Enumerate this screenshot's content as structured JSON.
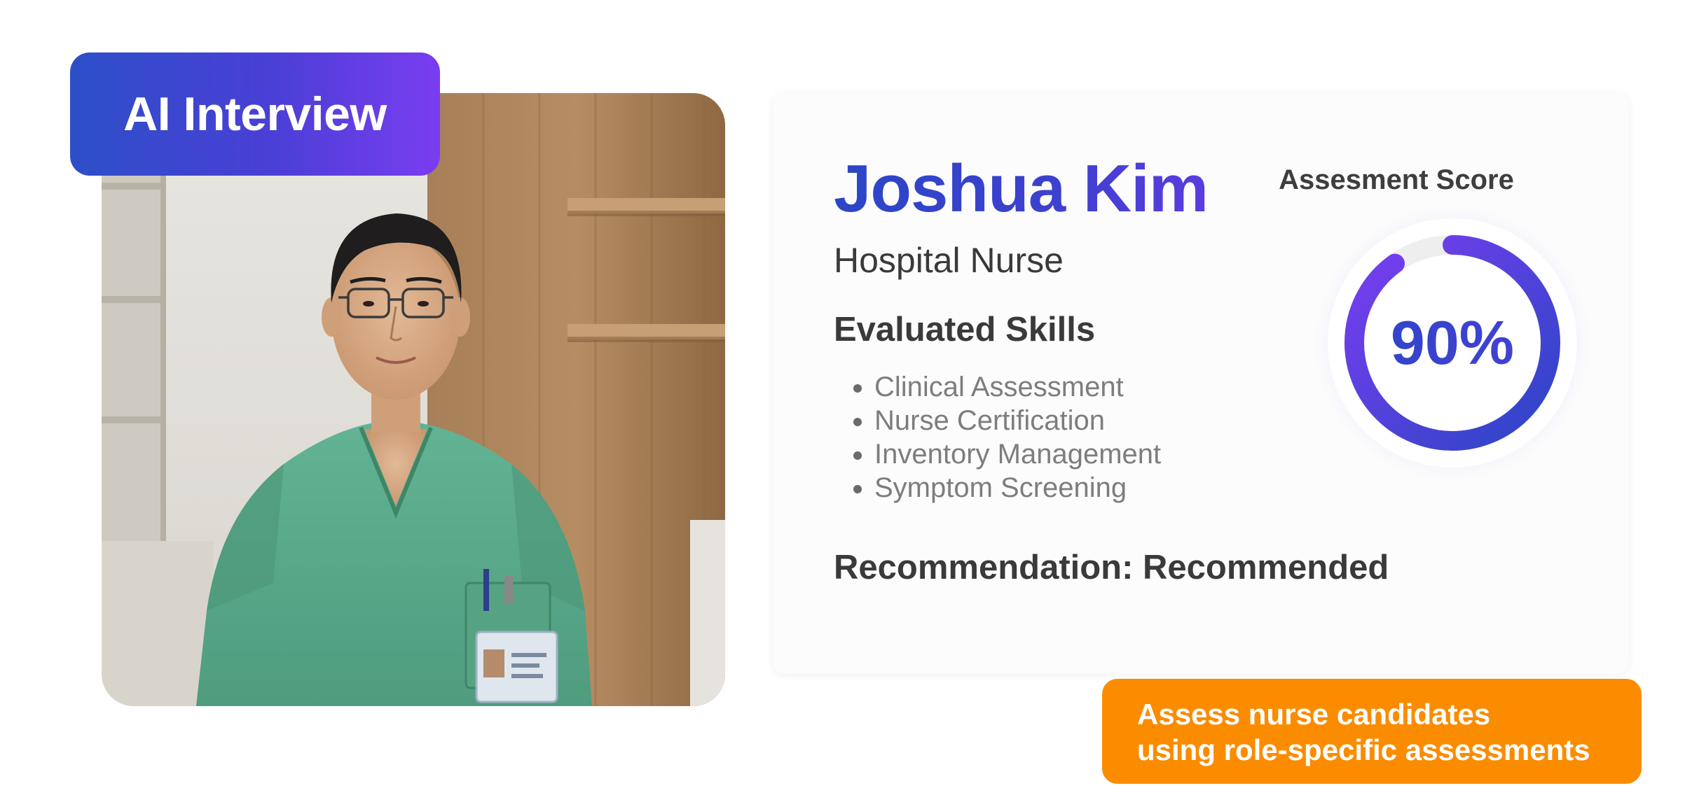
{
  "badge": {
    "label": "AI Interview"
  },
  "candidate": {
    "name": "Joshua Kim",
    "role": "Hospital Nurse",
    "skills_heading": "Evaluated Skills",
    "skills": [
      "Clinical Assessment",
      "Nurse Certification",
      "Inventory Management",
      "Symptom Screening"
    ],
    "recommendation": "Recommendation: Recommended"
  },
  "score": {
    "label": "Assesment Score",
    "value": 90,
    "display": "90%"
  },
  "callout": {
    "line1": "Assess nurse candidates",
    "line2": "using role-specific assessments"
  },
  "colors": {
    "brand_blue": "#2b46c6",
    "brand_purple": "#7a3df0",
    "callout_orange": "#fb8c00",
    "scrubs_green": "#5aa889"
  }
}
